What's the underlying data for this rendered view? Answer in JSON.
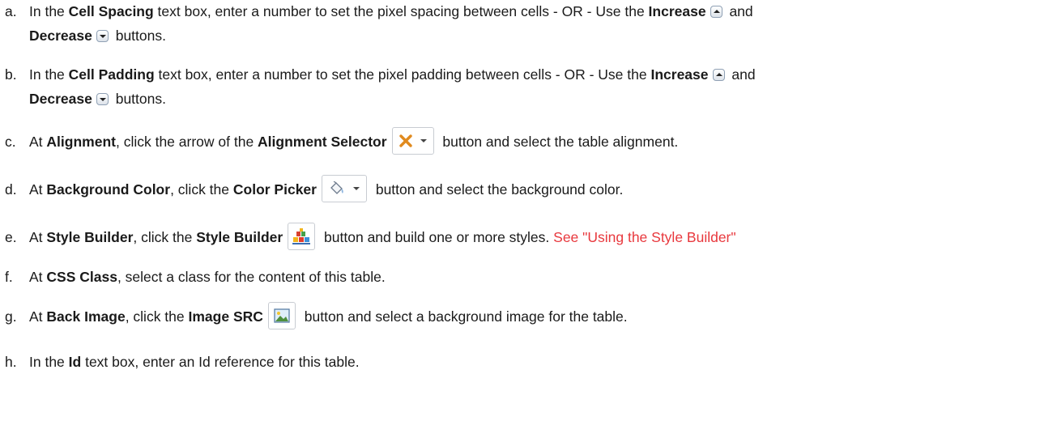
{
  "items": [
    {
      "letter": "a.",
      "t1": "In the ",
      "b1": "Cell Spacing",
      "t2": " text box, enter a number to set the pixel spacing between cells - OR - Use the ",
      "b2": "Increase",
      "t3": " and",
      "b3": "Decrease",
      "t4": " buttons."
    },
    {
      "letter": "b.",
      "t1": "In the ",
      "b1": "Cell Padding",
      "t2": " text box, enter a number to set the pixel padding between cells - OR - Use the ",
      "b2": "Increase",
      "t3": " and",
      "b3": "Decrease",
      "t4": " buttons."
    },
    {
      "letter": "c.",
      "t1": "At ",
      "b1": "Alignment",
      "t2": ", click the arrow of the ",
      "b2": "Alignment Selector",
      "t3": " button and select the table alignment.",
      "icon": "alignment-x-icon"
    },
    {
      "letter": "d.",
      "t1": "At ",
      "b1": "Background Color",
      "t2": ", click the ",
      "b2": "Color Picker",
      "t3": " button and select the background color.",
      "icon": "paint-bucket-icon"
    },
    {
      "letter": "e.",
      "t1": "At ",
      "b1": "Style Builder",
      "t2": ", click the ",
      "b2": "Style Builder",
      "t3": " button and build one or more styles. ",
      "link": "See \"Using the Style Builder\"",
      "icon": "style-builder-icon"
    },
    {
      "letter": "f.",
      "t1": "At ",
      "b1": "CSS Class",
      "t2": ", select a class for the content of this table."
    },
    {
      "letter": "g.",
      "t1": "At ",
      "b1": "Back Image",
      "t2": ", click the ",
      "b2": "Image SRC",
      "t3": " button and select a background image for the table.",
      "icon": "image-icon"
    },
    {
      "letter": "h.",
      "t1": "In the ",
      "b1": "Id",
      "t2": " text box, enter an Id reference for this table."
    }
  ],
  "colors": {
    "text": "#1a1a1a",
    "link": "#e8383d"
  }
}
